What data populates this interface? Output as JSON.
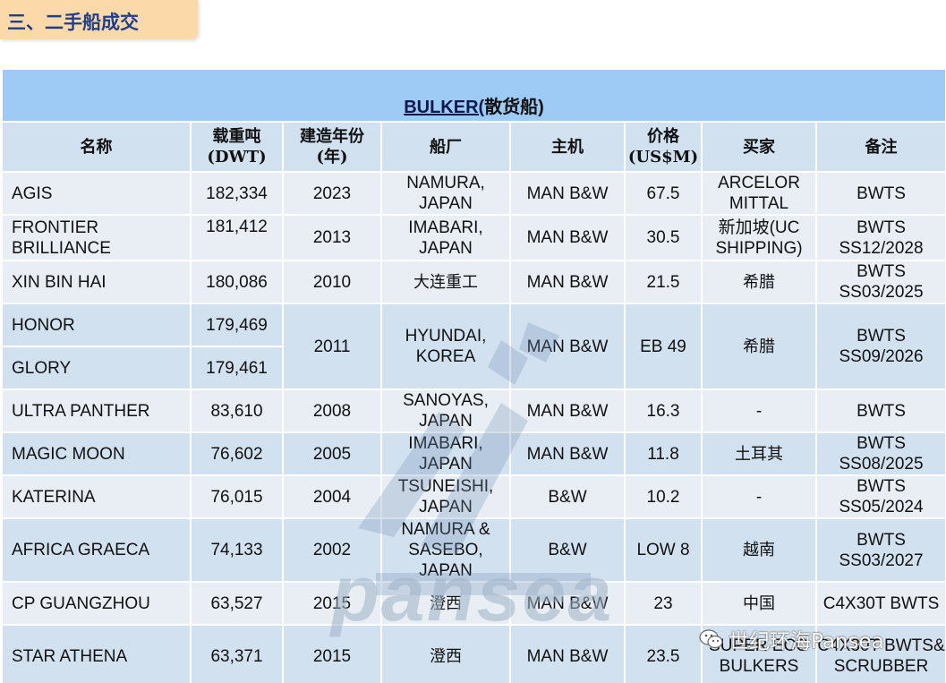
{
  "section_title": "三、二手船成交",
  "table_title": {
    "en": "BULKER(",
    "zh": "散货船)"
  },
  "headers": {
    "name": "名称",
    "dwt_1": "载重吨",
    "dwt_2": "(DWT)",
    "built_1": "建造年份",
    "built_2": "(年)",
    "yard": "船厂",
    "engine": "主机",
    "price_1": "价格",
    "price_2": "(US$M)",
    "buyer": "买家",
    "remark": "备注"
  },
  "rows": [
    {
      "name": "AGIS",
      "dwt": "182,334",
      "built": "2023",
      "yard": "NAMURA, JAPAN",
      "engine": "MAN B&W",
      "price": "67.5",
      "buyer": "ARCELOR MITTAL",
      "remark": "BWTS"
    },
    {
      "name": "FRONTIER BRILLIANCE",
      "dwt": "181,412",
      "built": "2013",
      "yard": "IMABARI, JAPAN",
      "engine": "MAN B&W",
      "price": "30.5",
      "buyer": "新加坡(UC SHIPPING)",
      "remark": "BWTS SS12/2028"
    },
    {
      "name": "XIN BIN HAI",
      "dwt": "180,086",
      "built": "2010",
      "yard": "大连重工",
      "engine": "MAN B&W",
      "price": "21.5",
      "buyer": "希腊",
      "remark": "BWTS SS03/2025"
    },
    {
      "name": "HONOR",
      "dwt": "179,469",
      "built": "2011",
      "yard": "HYUNDAI, KOREA",
      "engine": "MAN B&W",
      "price": "EB 49",
      "buyer": "希腊",
      "remark": "BWTS SS09/2026"
    },
    {
      "name": "GLORY",
      "dwt": "179,461"
    },
    {
      "name": "ULTRA PANTHER",
      "dwt": "83,610",
      "built": "2008",
      "yard": "SANOYAS, JAPAN",
      "engine": "MAN B&W",
      "price": "16.3",
      "buyer": "-",
      "remark": "BWTS"
    },
    {
      "name": "MAGIC MOON",
      "dwt": "76,602",
      "built": "2005",
      "yard": "IMABARI, JAPAN",
      "engine": "MAN B&W",
      "price": "11.8",
      "buyer": "土耳其",
      "remark": "BWTS SS08/2025"
    },
    {
      "name": "KATERINA",
      "dwt": "76,015",
      "built": "2004",
      "yard": "TSUNEISHI, JAPAN",
      "engine": "B&W",
      "price": "10.2",
      "buyer": "-",
      "remark": "BWTS SS05/2024"
    },
    {
      "name": "AFRICA GRAECA",
      "dwt": "74,133",
      "built": "2002",
      "yard": "NAMURA & SASEBO, JAPAN",
      "engine": "B&W",
      "price": "LOW 8",
      "buyer": "越南",
      "remark": "BWTS SS03/2027"
    },
    {
      "name": "CP GUANGZHOU",
      "dwt": "63,527",
      "built": "2015",
      "yard": "澄西",
      "engine": "MAN B&W",
      "price": "23",
      "buyer": "中国",
      "remark": "C4X30T BWTS"
    },
    {
      "name": "STAR ATHENA",
      "dwt": "63,371",
      "built": "2015",
      "yard": "澄西",
      "engine": "MAN B&W",
      "price": "23.5",
      "buyer": "SUPER ECO BULKERS",
      "remark": "C4X30T BWTS& SCRUBBER"
    }
  ],
  "watermark": {
    "text": "pansea"
  },
  "wechat_label": "世纪环海Pansea",
  "colors": {
    "title_bg": "#9ecbf6",
    "header_bg": "#d2e1ef",
    "row_light": "#e8eef4",
    "row_dark": "#d2e1ef",
    "banner_bg": "#fcd9a8",
    "banner_text": "#1f3f8c"
  }
}
